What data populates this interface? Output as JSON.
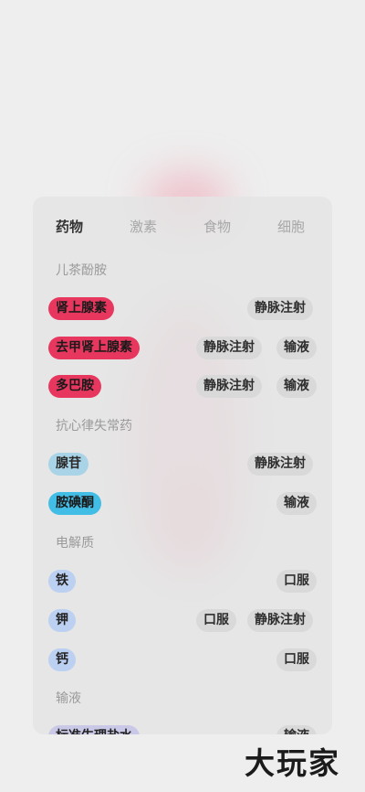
{
  "tabs": [
    "药物",
    "激素",
    "食物",
    "细胞"
  ],
  "sections": [
    "儿茶酚胺",
    "抗心律失常药",
    "电解质",
    "输液"
  ],
  "items": [
    {
      "name": "肾上腺素",
      "routes": [
        "静脉注射"
      ]
    },
    {
      "name": "去甲肾上腺素",
      "routes": [
        "静脉注射",
        "输液"
      ]
    },
    {
      "name": "多巴胺",
      "routes": [
        "静脉注射",
        "输液"
      ]
    },
    {
      "name": "腺苷",
      "routes": [
        "静脉注射"
      ]
    },
    {
      "name": "胺碘酮",
      "routes": [
        "输液"
      ]
    },
    {
      "name": "铁",
      "routes": [
        "口服"
      ]
    },
    {
      "name": "钾",
      "routes": [
        "口服",
        "静脉注射"
      ]
    },
    {
      "name": "钙",
      "routes": [
        "口服"
      ]
    },
    {
      "name": "标准生理盐水",
      "routes": [
        "输液"
      ]
    }
  ],
  "watermark": "大玩家",
  "colors": {
    "catecholamine": "#e8375f",
    "adenosine": "#a9d3e6",
    "amiodarone": "#42bde6",
    "electrolyte": "#bcd0f2",
    "infusion": "#c9c8e6",
    "route_chip": "#d9d9d9"
  }
}
